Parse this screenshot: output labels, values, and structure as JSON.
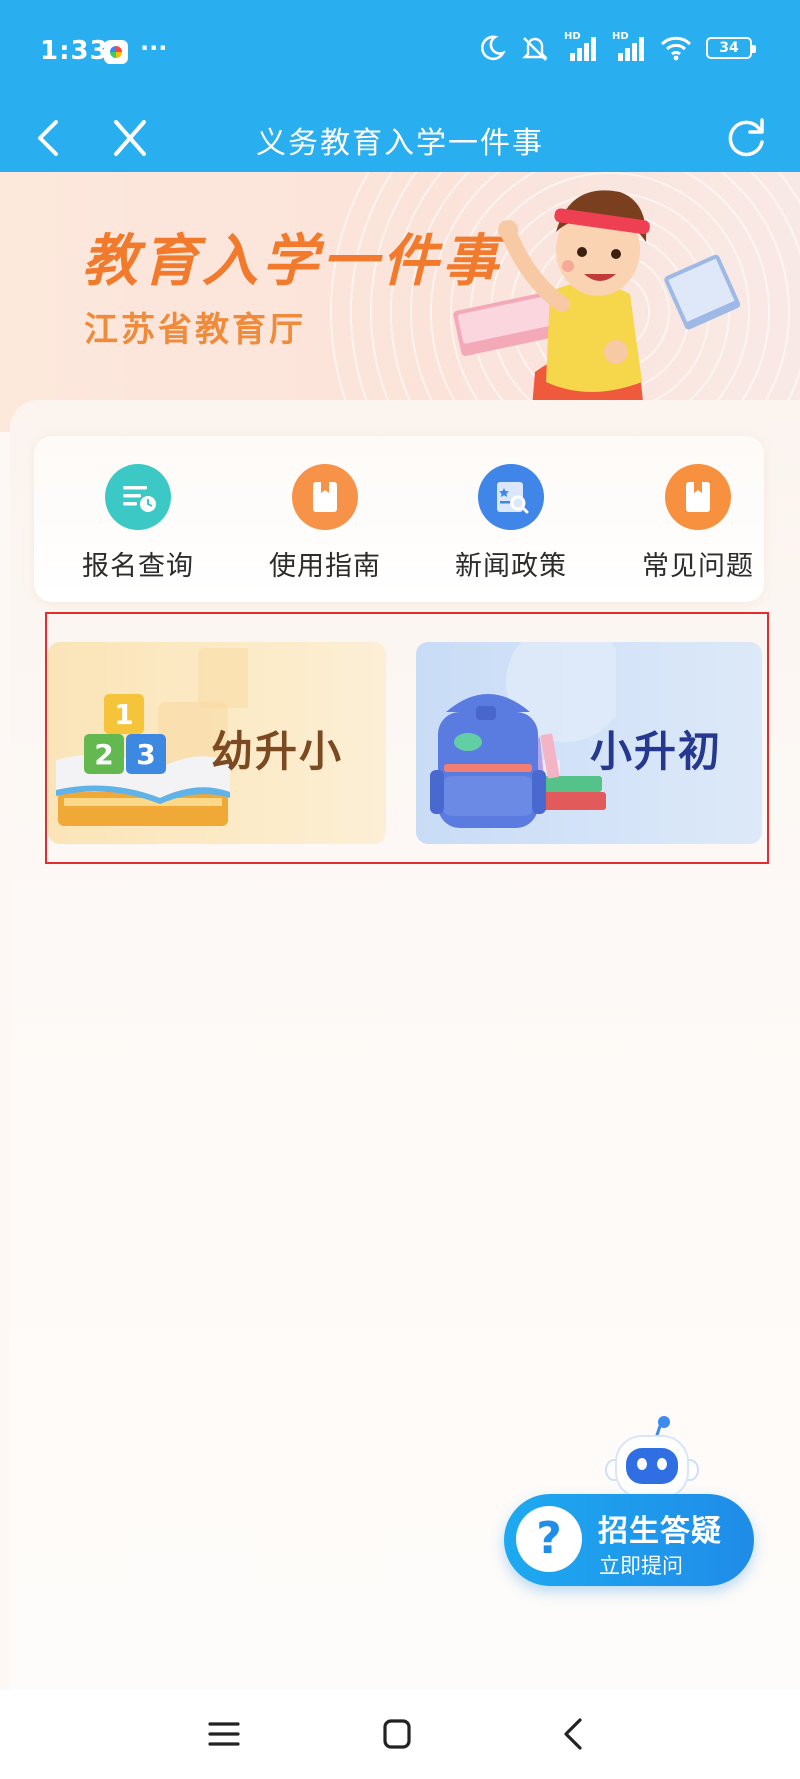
{
  "status_bar": {
    "time": "1:33",
    "more": "···",
    "signal_tag": "HD",
    "battery": "34",
    "icons": [
      "app-icon",
      "moon-icon",
      "mute-icon",
      "signal-icon",
      "signal-icon",
      "wifi-icon",
      "battery-icon"
    ]
  },
  "navbar": {
    "title": "义务教育入学一件事",
    "icons": [
      "back-icon",
      "close-icon",
      "refresh-icon"
    ]
  },
  "banner": {
    "title": "教育入学一件事",
    "subtitle": "江苏省教育厅"
  },
  "quick_links": [
    {
      "label": "报名查询",
      "icon": "list-clock-icon",
      "color": "#3cc9c6"
    },
    {
      "label": "使用指南",
      "icon": "book-icon",
      "color": "#f79348"
    },
    {
      "label": "新闻政策",
      "icon": "news-search-icon",
      "color": "#3f86e8"
    },
    {
      "label": "常见问题",
      "icon": "book-icon",
      "color": "#f7913f"
    }
  ],
  "entries": [
    {
      "label": "幼升小",
      "art": "number-blocks",
      "blocks": [
        "1",
        "2",
        "3"
      ]
    },
    {
      "label": "小升初",
      "art": "backpack"
    }
  ],
  "help": {
    "title": "招生答疑",
    "subtitle": "立即提问",
    "icon": "question-icon"
  },
  "system_nav": [
    "menu-icon",
    "home-icon",
    "back-icon"
  ],
  "colors": {
    "primary": "#29aef0",
    "banner_title": "#f27a2c",
    "highlight": "#e52c2c",
    "left_entry_text": "#7b4a22",
    "right_entry_text": "#25378e"
  }
}
